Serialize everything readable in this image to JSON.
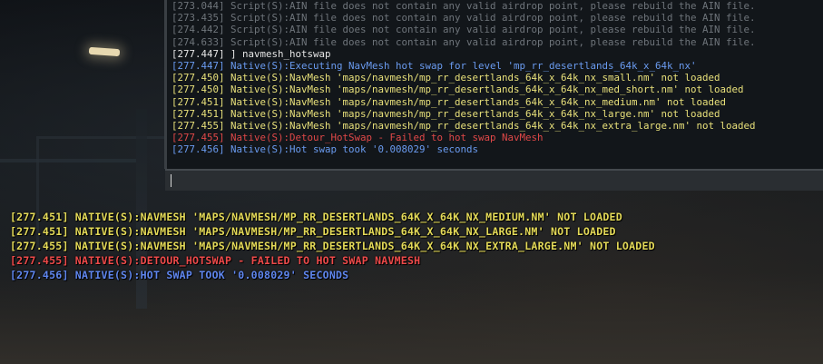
{
  "console": {
    "lines": [
      {
        "text": "[273.044] Script(S):AIN file does not contain any valid airdrop point, please rebuild the AIN file.",
        "color": "#6e747a"
      },
      {
        "text": "[273.435] Script(S):AIN file does not contain any valid airdrop point, please rebuild the AIN file.",
        "color": "#6e747a"
      },
      {
        "text": "[274.442] Script(S):AIN file does not contain any valid airdrop point, please rebuild the AIN file.",
        "color": "#6e747a"
      },
      {
        "text": "[274.633] Script(S):AIN file does not contain any valid airdrop point, please rebuild the AIN file.",
        "color": "#6e747a"
      },
      {
        "text": "[277.447] ] navmesh_hotswap",
        "color": "#e6e6e6"
      },
      {
        "text": "[277.447] Native(S):Executing NavMesh hot swap for level 'mp_rr_desertlands_64k_x_64k_nx'",
        "color": "#6a9bf0"
      },
      {
        "text": "[277.450] Native(S):NavMesh 'maps/navmesh/mp_rr_desertlands_64k_x_64k_nx_small.nm' not loaded",
        "color": "#e8e07a"
      },
      {
        "text": "[277.450] Native(S):NavMesh 'maps/navmesh/mp_rr_desertlands_64k_x_64k_nx_med_short.nm' not loaded",
        "color": "#e8e07a"
      },
      {
        "text": "[277.451] Native(S):NavMesh 'maps/navmesh/mp_rr_desertlands_64k_x_64k_nx_medium.nm' not loaded",
        "color": "#e8e07a"
      },
      {
        "text": "[277.451] Native(S):NavMesh 'maps/navmesh/mp_rr_desertlands_64k_x_64k_nx_large.nm' not loaded",
        "color": "#e8e07a"
      },
      {
        "text": "[277.455] Native(S):NavMesh 'maps/navmesh/mp_rr_desertlands_64k_x_64k_nx_extra_large.nm' not loaded",
        "color": "#e8e07a"
      },
      {
        "text": "[277.455] Native(S):Detour_HotSwap - Failed to hot swap NavMesh",
        "color": "#e04848"
      },
      {
        "text": "[277.456] Native(S):Hot swap took '0.008029' seconds",
        "color": "#6a9bf0"
      }
    ],
    "input_value": ""
  },
  "overlay": {
    "lines": [
      {
        "text": "[277.451] NATIVE(S):NAVMESH 'MAPS/NAVMESH/MP_RR_DESERTLANDS_64K_X_64K_NX_MEDIUM.NM' NOT LOADED",
        "color": "#e4da58"
      },
      {
        "text": "[277.451] NATIVE(S):NAVMESH 'MAPS/NAVMESH/MP_RR_DESERTLANDS_64K_X_64K_NX_LARGE.NM' NOT LOADED",
        "color": "#e4da58"
      },
      {
        "text": "[277.455] NATIVE(S):NAVMESH 'MAPS/NAVMESH/MP_RR_DESERTLANDS_64K_X_64K_NX_EXTRA_LARGE.NM' NOT LOADED",
        "color": "#e4da58"
      },
      {
        "text": "[277.455] NATIVE(S):DETOUR_HOTSWAP - FAILED TO HOT SWAP NAVMESH",
        "color": "#ee4a4a"
      },
      {
        "text": "[277.456] NATIVE(S):HOT SWAP TOOK '0.008029' SECONDS",
        "color": "#5f86ee"
      }
    ]
  }
}
